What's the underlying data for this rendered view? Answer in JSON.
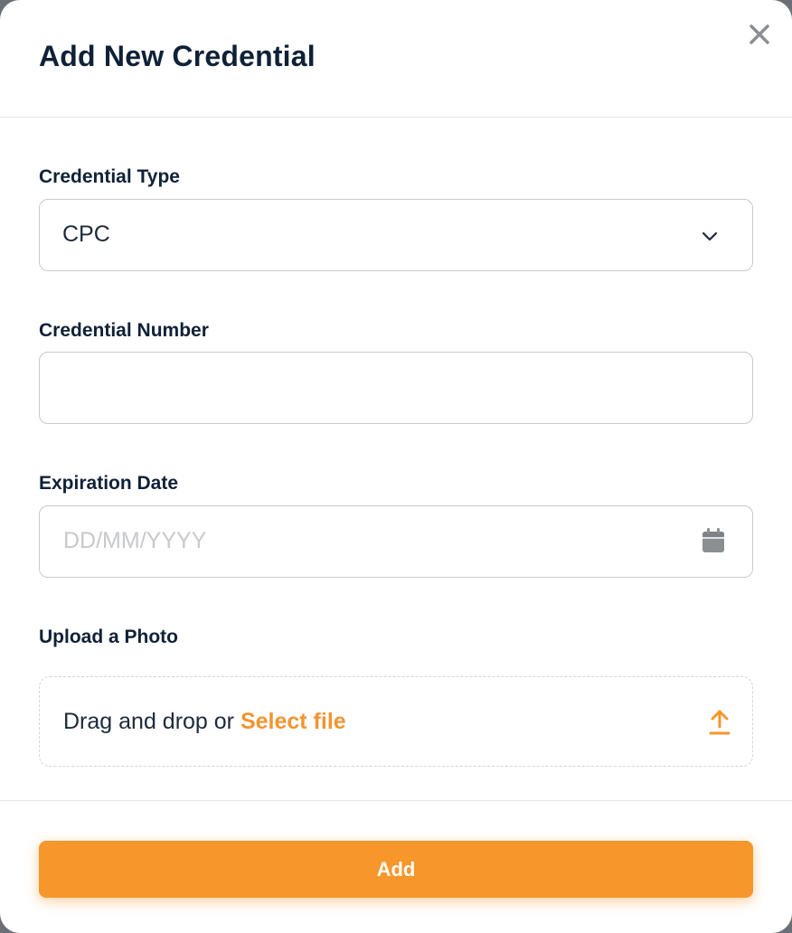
{
  "modal": {
    "title": "Add New Credential"
  },
  "form": {
    "credential_type": {
      "label": "Credential Type",
      "selected": "CPC"
    },
    "credential_number": {
      "label": "Credential Number",
      "value": ""
    },
    "expiration_date": {
      "label": "Expiration Date",
      "placeholder": "DD/MM/YYYY"
    },
    "upload": {
      "label": "Upload a Photo",
      "prompt": "Drag and drop or ",
      "select_link": "Select file"
    }
  },
  "footer": {
    "submit_label": "Add"
  },
  "colors": {
    "accent": "#f7962b",
    "title": "#0f2137",
    "border": "#c8cace"
  },
  "icons": {
    "close": "close-icon",
    "dropdown": "chevron-down-icon",
    "date": "calendar-icon",
    "upload": "upload-icon"
  }
}
